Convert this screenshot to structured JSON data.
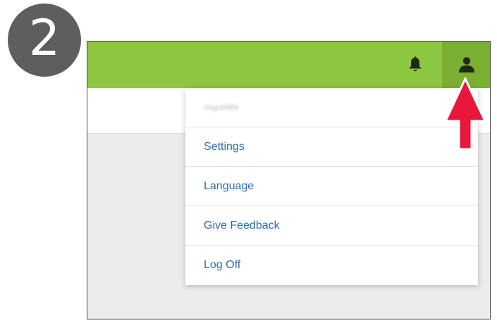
{
  "step": {
    "number": "2"
  },
  "header": {
    "bar_color": "#8dc63f",
    "active_button_color": "#7aaf32",
    "icons": {
      "notifications": "bell-icon",
      "account": "user-icon"
    }
  },
  "user_menu": {
    "username": "rmgu0984",
    "items": [
      {
        "label": "Settings"
      },
      {
        "label": "Language"
      },
      {
        "label": "Give Feedback"
      },
      {
        "label": "Log Off"
      }
    ]
  },
  "annotation": {
    "arrow_color": "#e8173c"
  }
}
